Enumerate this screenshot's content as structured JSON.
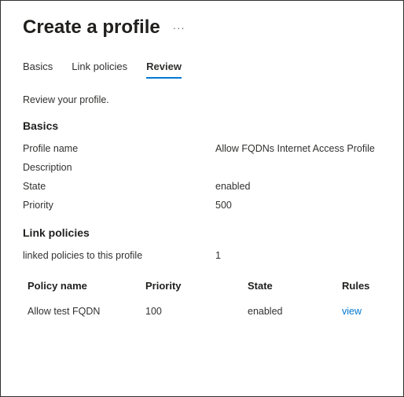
{
  "header": {
    "title": "Create a profile"
  },
  "tabs": {
    "items": [
      {
        "label": "Basics"
      },
      {
        "label": "Link policies"
      },
      {
        "label": "Review"
      }
    ],
    "active_index": 2
  },
  "subtitle": "Review your profile.",
  "basics": {
    "heading": "Basics",
    "rows": {
      "profile_name": {
        "label": "Profile name",
        "value": "Allow FQDNs Internet Access Profile"
      },
      "description": {
        "label": "Description",
        "value": ""
      },
      "state": {
        "label": "State",
        "value": "enabled"
      },
      "priority": {
        "label": "Priority",
        "value": "500"
      }
    }
  },
  "link_policies": {
    "heading": "Link policies",
    "summary": {
      "label": "linked policies to this profile",
      "value": "1"
    },
    "table": {
      "headers": {
        "name": "Policy name",
        "priority": "Priority",
        "state": "State",
        "rules": "Rules"
      },
      "rows": [
        {
          "name": "Allow test FQDN",
          "priority": "100",
          "state": "enabled",
          "rules": "view"
        }
      ]
    }
  }
}
